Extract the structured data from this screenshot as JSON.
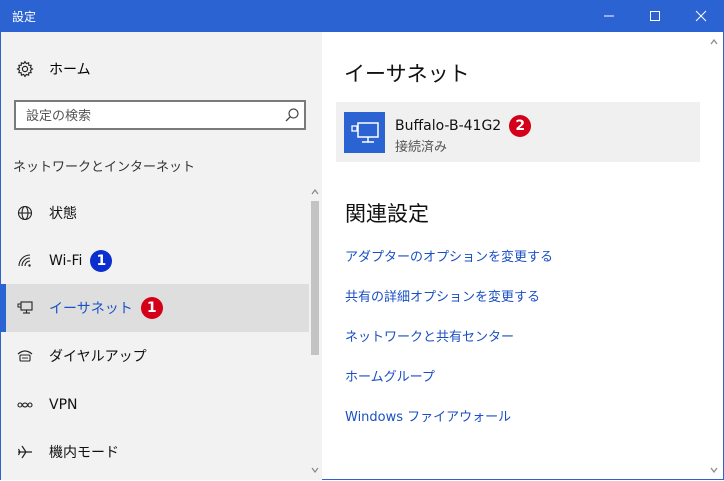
{
  "window": {
    "title": "設定",
    "titlebar_color": "#2b63d2",
    "controls": [
      "minimize-icon",
      "maximize-icon",
      "close-icon"
    ]
  },
  "sidebar": {
    "home_label": "ホーム",
    "search_placeholder": "設定の検索",
    "section_label": "ネットワークとインターネット",
    "items": [
      {
        "label": "状態",
        "icon": "globe-icon"
      },
      {
        "label": "Wi-Fi",
        "icon": "wifi-icon",
        "badge": "1"
      },
      {
        "label": "イーサネット",
        "icon": "ethernet-icon",
        "badge": "1",
        "selected": true
      },
      {
        "label": "ダイヤルアップ",
        "icon": "dialup-icon"
      },
      {
        "label": "VPN",
        "icon": "vpn-icon"
      },
      {
        "label": "機内モード",
        "icon": "airplane-icon"
      }
    ]
  },
  "main": {
    "title": "イーサネット",
    "network": {
      "name": "Buffalo-B-41G2",
      "status": "接続済み",
      "badge": "2"
    },
    "related_title": "関連設定",
    "links": [
      "アダプターのオプションを変更する",
      "共有の詳細オプションを変更する",
      "ネットワークと共有センター",
      "ホームグループ",
      "Windows ファイアウォール"
    ]
  },
  "colors": {
    "accent": "#2b63d2",
    "link": "#1a4fc4",
    "badge_blue": "#0b2fcf",
    "badge_red": "#d4001a"
  }
}
